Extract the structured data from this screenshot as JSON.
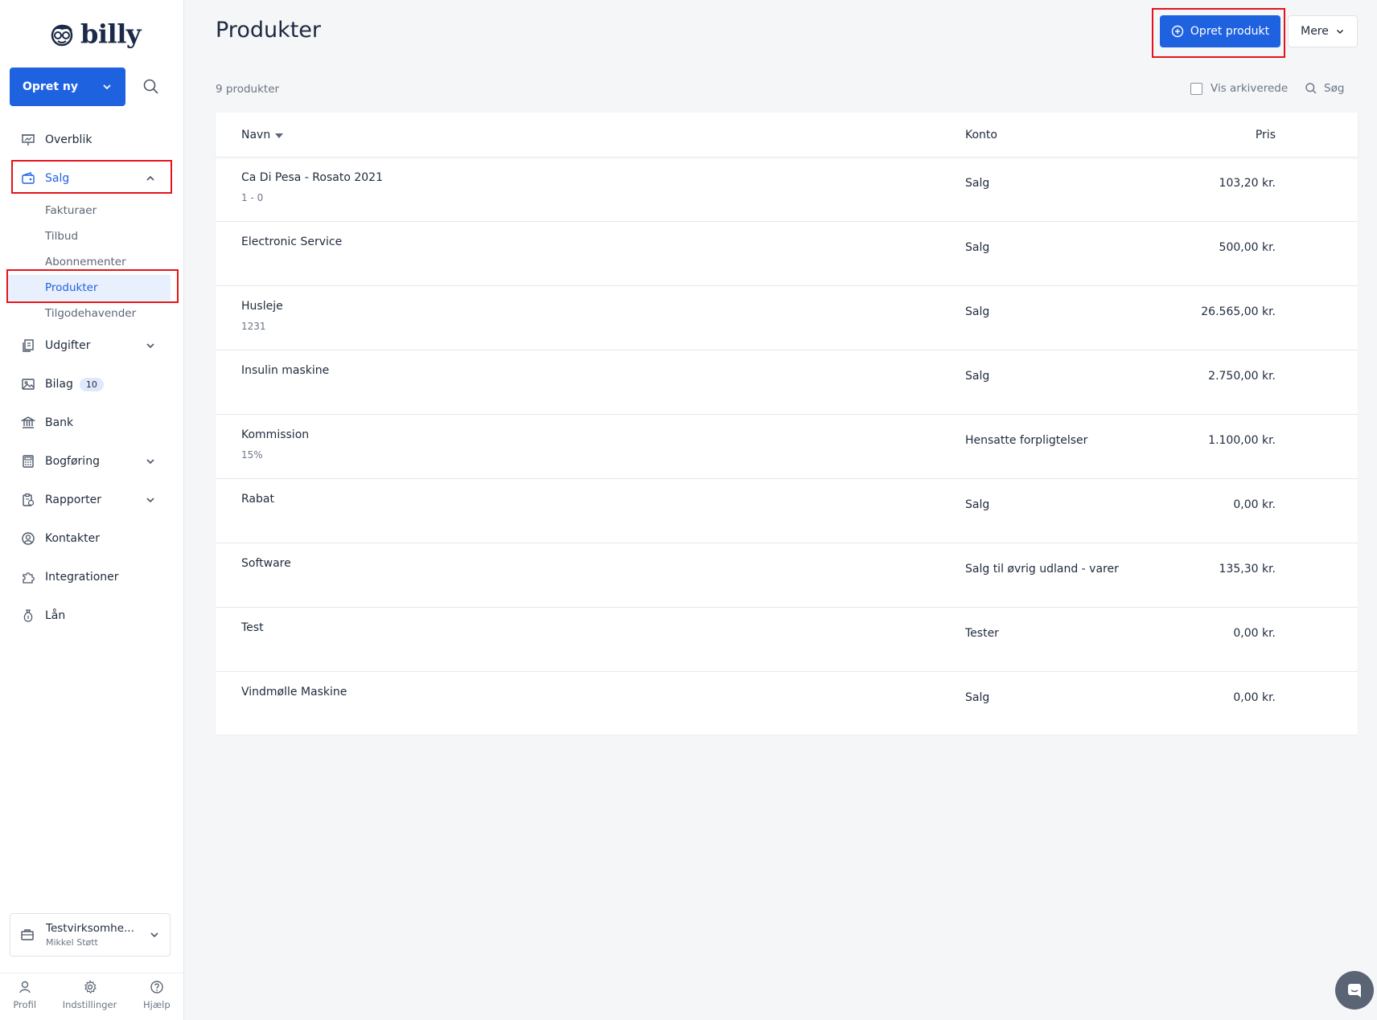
{
  "brand": {
    "name": "billy"
  },
  "sidebar": {
    "create_label": "Opret ny",
    "items": [
      {
        "label": "Overblik",
        "icon": "presentation-icon"
      },
      {
        "label": "Salg",
        "icon": "wallet-icon",
        "expanded": true
      },
      {
        "label": "Udgifter",
        "icon": "documents-icon",
        "expanded": false
      },
      {
        "label": "Bilag",
        "icon": "image-icon",
        "badge": "10"
      },
      {
        "label": "Bank",
        "icon": "bank-icon"
      },
      {
        "label": "Bogføring",
        "icon": "calculator-icon",
        "expanded": false
      },
      {
        "label": "Rapporter",
        "icon": "report-icon",
        "expanded": false
      },
      {
        "label": "Kontakter",
        "icon": "contact-icon"
      },
      {
        "label": "Integrationer",
        "icon": "puzzle-icon"
      },
      {
        "label": "Lån",
        "icon": "money-bag-icon"
      }
    ],
    "salg_sub": [
      "Fakturaer",
      "Tilbud",
      "Abonnementer",
      "Produkter",
      "Tilgodehavender"
    ],
    "active_sub": "Produkter",
    "company": {
      "name": "Testvirksomhe...",
      "user": "Mikkel Støtt"
    },
    "bottom": [
      "Profil",
      "Indstillinger",
      "Hjælp"
    ]
  },
  "header": {
    "title": "Produkter",
    "primary_label": "Opret produkt",
    "more_label": "Mere"
  },
  "toolbar": {
    "count": "9 produkter",
    "archive_label": "Vis arkiverede",
    "search_label": "Søg"
  },
  "table": {
    "columns": {
      "name": "Navn",
      "account": "Konto",
      "price": "Pris"
    },
    "rows": [
      {
        "name": "Ca Di Pesa - Rosato 2021",
        "desc": "1 - 0",
        "account": "Salg",
        "price": "103,20 kr."
      },
      {
        "name": "Electronic Service",
        "desc": "",
        "account": "Salg",
        "price": "500,00 kr."
      },
      {
        "name": "Husleje",
        "desc": "1231",
        "account": "Salg",
        "price": "26.565,00 kr."
      },
      {
        "name": "Insulin maskine",
        "desc": "",
        "account": "Salg",
        "price": "2.750,00 kr."
      },
      {
        "name": "Kommission",
        "desc": "15%",
        "account": "Hensatte forpligtelser",
        "price": "1.100,00 kr."
      },
      {
        "name": "Rabat",
        "desc": "",
        "account": "Salg",
        "price": "0,00 kr."
      },
      {
        "name": "Software",
        "desc": "",
        "account": "Salg til øvrig udland - varer",
        "price": "135,30 kr."
      },
      {
        "name": "Test",
        "desc": "",
        "account": "Tester",
        "price": "0,00 kr."
      },
      {
        "name": "Vindmølle Maskine",
        "desc": "",
        "account": "Salg",
        "price": "0,00 kr."
      }
    ]
  },
  "colors": {
    "accent": "#1f62e0",
    "highlight": "#e3141b",
    "text": "#1e2a3c",
    "muted": "#6b7685"
  }
}
